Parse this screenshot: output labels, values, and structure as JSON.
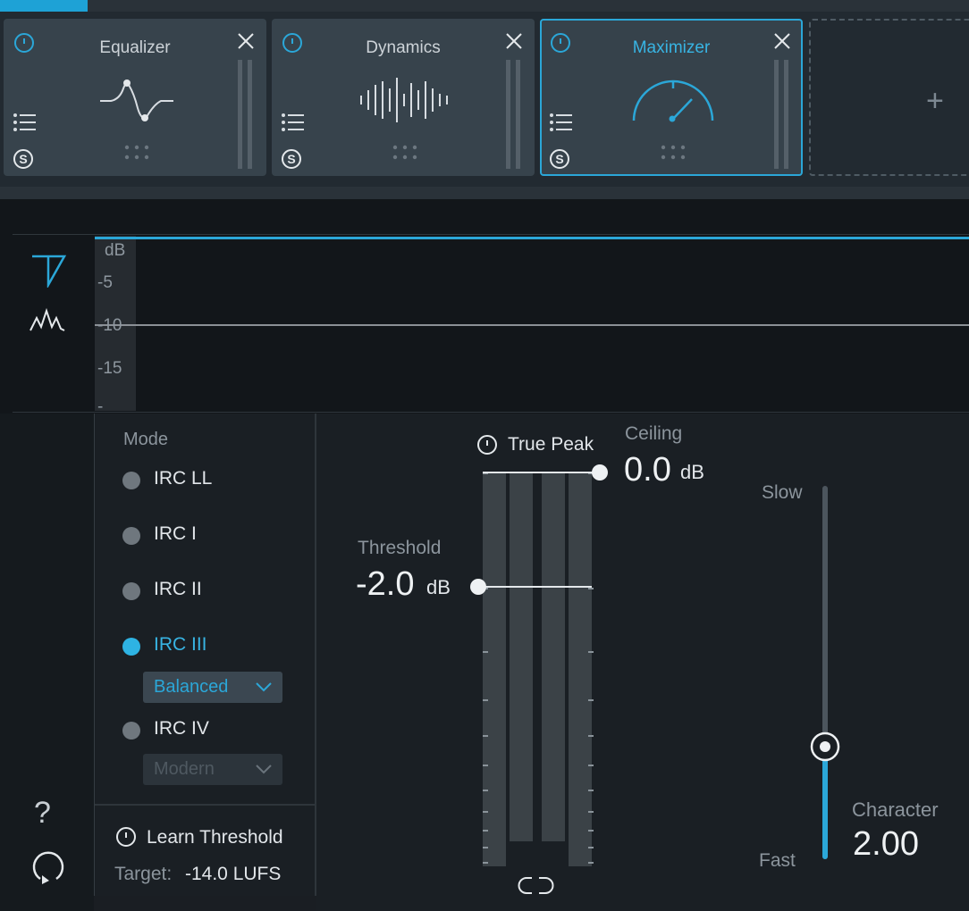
{
  "modules": [
    {
      "title": "Equalizer",
      "active": false
    },
    {
      "title": "Dynamics",
      "active": false
    },
    {
      "title": "Maximizer",
      "active": true
    }
  ],
  "add_module_symbol": "+",
  "graph": {
    "unit_label": "dB",
    "ticks": [
      "-5",
      "-10",
      "-15",
      "-"
    ]
  },
  "mode": {
    "title": "Mode",
    "items": [
      {
        "label": "IRC LL",
        "selected": false
      },
      {
        "label": "IRC I",
        "selected": false
      },
      {
        "label": "IRC II",
        "selected": false
      },
      {
        "label": "IRC III",
        "selected": true
      },
      {
        "label": "IRC IV",
        "selected": false
      }
    ],
    "irc3_style": "Balanced",
    "irc4_style": "Modern"
  },
  "learn": {
    "label": "Learn Threshold",
    "target_label": "Target:",
    "target_value": "-14.0 LUFS"
  },
  "true_peak": {
    "label": "True Peak"
  },
  "ceiling": {
    "title": "Ceiling",
    "value": "0.0",
    "unit": "dB"
  },
  "threshold": {
    "title": "Threshold",
    "value": "-2.0",
    "unit": "dB"
  },
  "character": {
    "title": "Character",
    "value": "2.00",
    "slow_label": "Slow",
    "fast_label": "Fast",
    "level_fraction": 0.3
  },
  "help_symbol": "?",
  "colors": {
    "accent": "#2ba7d8",
    "module_bg": "#37434c",
    "panel_bg": "#1a1f24"
  },
  "icons": [
    "power-icon",
    "close-icon",
    "list-icon",
    "solo-icon",
    "grip-dots-icon",
    "limiter-view-icon",
    "waveform-view-icon",
    "help-icon",
    "history-icon",
    "link-icon",
    "chevron-down-icon"
  ]
}
